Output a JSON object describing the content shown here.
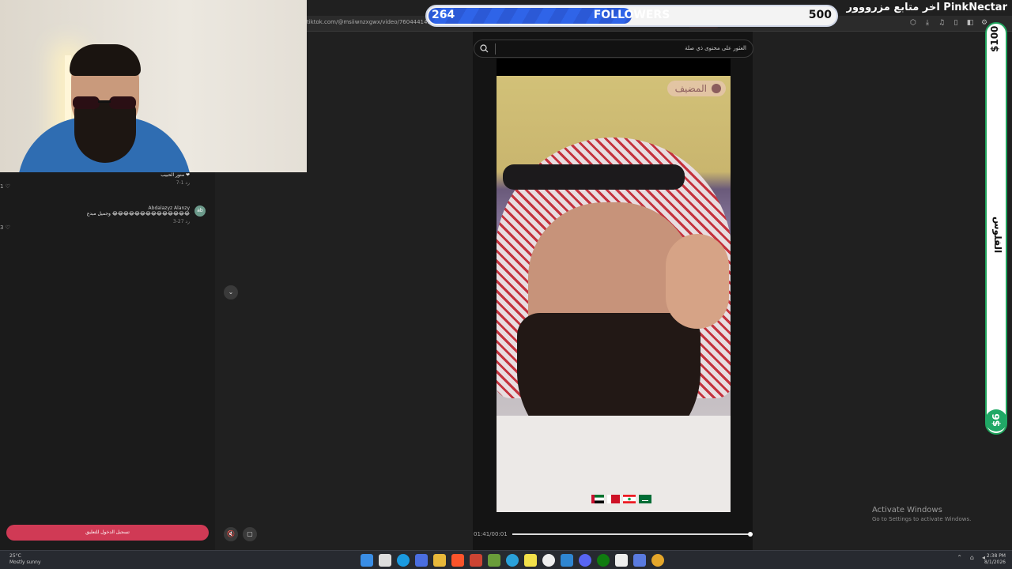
{
  "browser": {
    "url": "tiktok.com/@msiiwnzxgwx/video/7604441432992",
    "toolbar_icons": [
      "extensions-icon",
      "download-icon",
      "music-icon",
      "reading-icon",
      "sidebar-icon",
      "settings-icon"
    ]
  },
  "follower_goal": {
    "current": "264",
    "label": "FOLLOWERS",
    "target": "500",
    "progress_fraction": 0.5,
    "title": "اخر متابع مزرووور PinkNectar"
  },
  "search": {
    "placeholder": "العثور على محتوى ذي صلة"
  },
  "video": {
    "host_badge": "المضيف",
    "time": "01:41/00:01",
    "progress_fraction": 0.99
  },
  "comments": [
    {
      "name": "",
      "text": "منور الحبيب ❤",
      "meta": "7-1  رد",
      "likes": "1 ♡"
    },
    {
      "name": "Abdalazyz Alanzy",
      "text": "وجميل مبدع 😂😂😂😂😂😂😂😂😂😂😂😂😂😂",
      "meta": "3-27  رد",
      "likes": "3 ♡",
      "avatar": "ab"
    }
  ],
  "login_button": "تسجيل الدخول للتعليق",
  "donation": {
    "top": "$100",
    "middle": "الفلوس",
    "bottom": "$6"
  },
  "activation": {
    "title": "Activate Windows",
    "subtitle": "Go to Settings to activate Windows."
  },
  "taskbar": {
    "weather_temp": "25°C",
    "weather_desc": "Mostly sunny",
    "time": "2:38 PM",
    "date": "8/1/2026"
  },
  "colors": {
    "follower_fill": "#2f64e8",
    "donation_green": "#20a866",
    "login_pink": "#d03a55"
  }
}
